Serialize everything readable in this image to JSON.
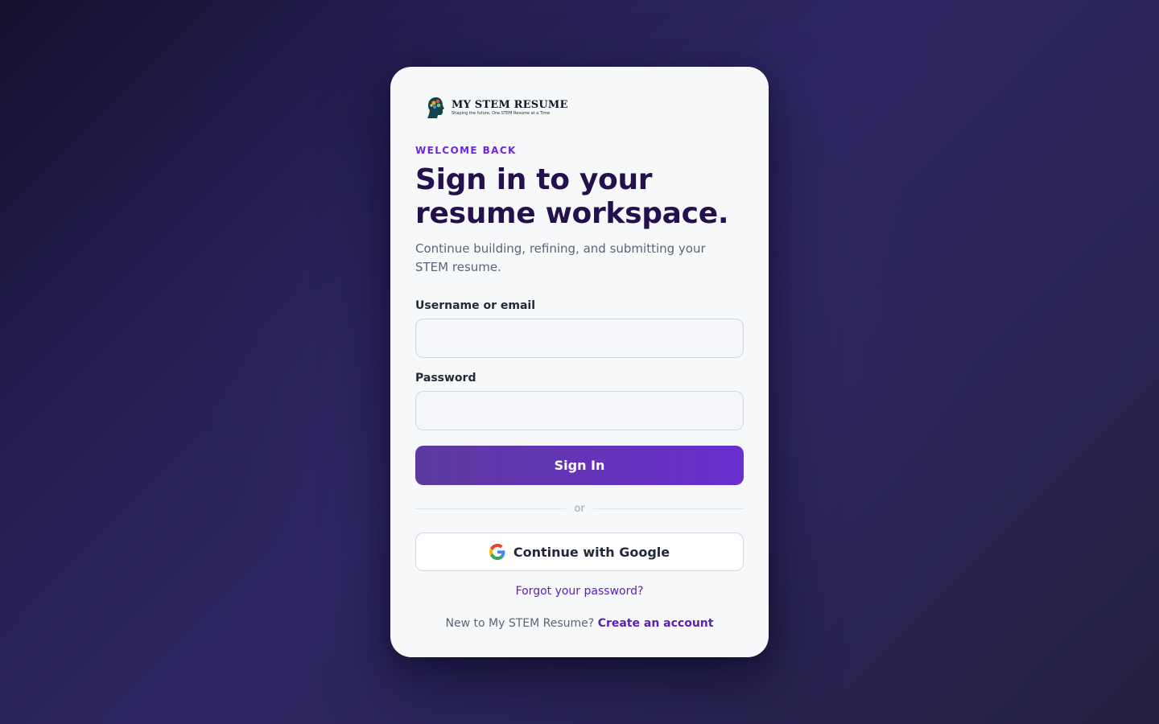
{
  "brand": {
    "name": "MY STEM RESUME",
    "tagline": "Shaping the future, One STEM Resume at a Time",
    "logo_icon": "head-silhouette-icon"
  },
  "hero": {
    "eyebrow": "WELCOME BACK",
    "title": "Sign in to your resume workspace.",
    "subtitle": "Continue building, refining, and submitting your STEM resume."
  },
  "form": {
    "username": {
      "label": "Username or email",
      "value": "",
      "placeholder": ""
    },
    "password": {
      "label": "Password",
      "value": "",
      "placeholder": ""
    },
    "submit_label": "Sign In",
    "divider_text": "or",
    "google_label": "Continue with Google",
    "google_icon": "google-icon"
  },
  "links": {
    "forgot_password": "Forgot your password?",
    "signup_prompt": "New to My STEM Resume?",
    "signup_link": "Create an account"
  },
  "colors": {
    "accent": "#6d28d9",
    "title": "#24104d",
    "button_start": "#5d3a9e",
    "button_end": "#6a2fd0",
    "background": "#2e2764"
  }
}
